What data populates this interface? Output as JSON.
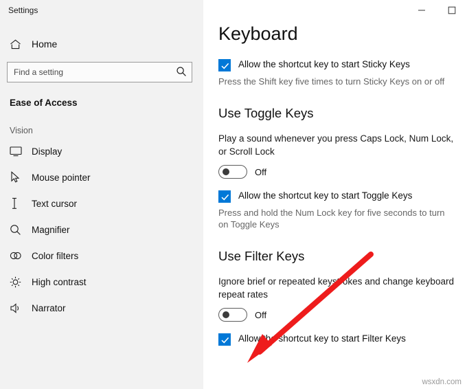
{
  "window": {
    "title": "Settings",
    "controls": {
      "minimize": "minimize-icon",
      "maximize": "maximize-icon"
    }
  },
  "sidebar": {
    "home_label": "Home",
    "home_icon": "home-icon",
    "search": {
      "placeholder": "Find a setting",
      "value": "",
      "icon": "search-icon"
    },
    "section_title": "Ease of Access",
    "group_label": "Vision",
    "items": [
      {
        "label": "Display",
        "icon": "monitor-icon"
      },
      {
        "label": "Mouse pointer",
        "icon": "mouse-pointer-icon"
      },
      {
        "label": "Text cursor",
        "icon": "text-cursor-icon"
      },
      {
        "label": "Magnifier",
        "icon": "magnifier-icon"
      },
      {
        "label": "Color filters",
        "icon": "color-filters-icon"
      },
      {
        "label": "High contrast",
        "icon": "high-contrast-icon"
      },
      {
        "label": "Narrator",
        "icon": "narrator-icon"
      }
    ]
  },
  "main": {
    "page_title": "Keyboard",
    "sticky_keys": {
      "checkbox_label": "Allow the shortcut key to start Sticky Keys",
      "checked": true,
      "description": "Press the Shift key five times to turn Sticky Keys on or off"
    },
    "toggle_keys": {
      "heading": "Use Toggle Keys",
      "description": "Play a sound whenever you press Caps Lock, Num Lock, or Scroll Lock",
      "toggle_state": "Off",
      "checkbox_label": "Allow the shortcut key to start Toggle Keys",
      "checked": true,
      "hint": "Press and hold the Num Lock key for five seconds to turn on Toggle Keys"
    },
    "filter_keys": {
      "heading": "Use Filter Keys",
      "description": "Ignore brief or repeated keystrokes and change keyboard repeat rates",
      "toggle_state": "Off",
      "checkbox_label": "Allow the shortcut key to start Filter Keys",
      "checked": true
    }
  },
  "annotation": {
    "arrow_color": "#ee1c1c",
    "arrow_name": "red-arrow-annotation"
  },
  "watermark": "wsxdn.com",
  "colors": {
    "accent": "#0078d7",
    "sidebar_bg": "#f2f2f2",
    "text": "#111111",
    "muted_text": "#666666"
  }
}
